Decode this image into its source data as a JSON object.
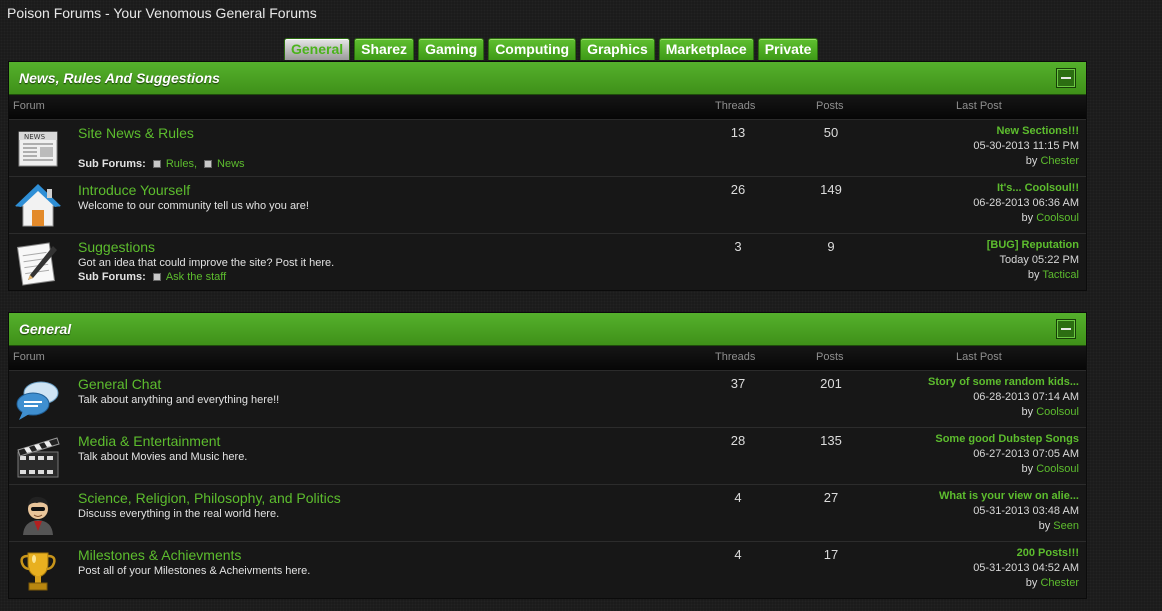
{
  "site_title": "Poison Forums - Your Venomous General Forums",
  "tabs": [
    {
      "label": "General",
      "active": true
    },
    {
      "label": "Sharez"
    },
    {
      "label": "Gaming"
    },
    {
      "label": "Computing"
    },
    {
      "label": "Graphics"
    },
    {
      "label": "Marketplace"
    },
    {
      "label": "Private"
    }
  ],
  "columns": {
    "forum": "Forum",
    "threads": "Threads",
    "posts": "Posts",
    "last_post": "Last Post"
  },
  "categories": [
    {
      "title": "News, Rules And Suggestions",
      "forums": [
        {
          "name": "Site News & Rules",
          "icon": "newspaper-icon",
          "description": "",
          "subforums_label": "Sub Forums:",
          "subforums": [
            "Rules,",
            "News"
          ],
          "threads": "13",
          "posts": "50",
          "last_post": {
            "title": "New Sections!!!",
            "date": "05-30-2013 11:15 PM",
            "by": "by",
            "user": "Chester"
          }
        },
        {
          "name": "Introduce Yourself",
          "icon": "house-icon",
          "description": "Welcome to our community tell us who you are!",
          "threads": "26",
          "posts": "149",
          "last_post": {
            "title": "It's... Coolsoul!!",
            "date": "06-28-2013 06:36 AM",
            "by": "by",
            "user": "Coolsoul"
          }
        },
        {
          "name": "Suggestions",
          "icon": "notepad-pen-icon",
          "description": "Got an idea that could improve the site? Post it here.",
          "subforums_label": "Sub Forums:",
          "subforums": [
            "Ask the staff"
          ],
          "threads": "3",
          "posts": "9",
          "last_post": {
            "title": "[BUG] Reputation",
            "date": "Today 05:22 PM",
            "by": "by",
            "user": "Tactical"
          }
        }
      ]
    },
    {
      "title": "General",
      "forums": [
        {
          "name": "General Chat",
          "icon": "chat-bubbles-icon",
          "description": "Talk about anything and everything here!!",
          "threads": "37",
          "posts": "201",
          "last_post": {
            "title": "Story of some random kids...",
            "date": "06-28-2013 07:14 AM",
            "by": "by",
            "user": "Coolsoul"
          }
        },
        {
          "name": "Media & Entertainment",
          "icon": "clapperboard-icon",
          "description": "Talk about Movies and Music here.",
          "threads": "28",
          "posts": "135",
          "last_post": {
            "title": "Some good Dubstep Songs",
            "date": "06-27-2013 07:05 AM",
            "by": "by",
            "user": "Coolsoul"
          }
        },
        {
          "name": "Science, Religion, Philosophy, and Politics",
          "icon": "person-avatar-icon",
          "description": "Discuss everything in the real world here.",
          "threads": "4",
          "posts": "27",
          "last_post": {
            "title": "What is your view on alie...",
            "date": "05-31-2013 03:48 AM",
            "by": "by",
            "user": "Seen"
          }
        },
        {
          "name": "Milestones & Achievments",
          "icon": "trophy-icon",
          "description": "Post all of your Milestones & Acheivments here.",
          "threads": "4",
          "posts": "17",
          "last_post": {
            "title": "200 Posts!!!",
            "date": "05-31-2013 04:52 AM",
            "by": "by",
            "user": "Chester"
          }
        }
      ]
    }
  ]
}
